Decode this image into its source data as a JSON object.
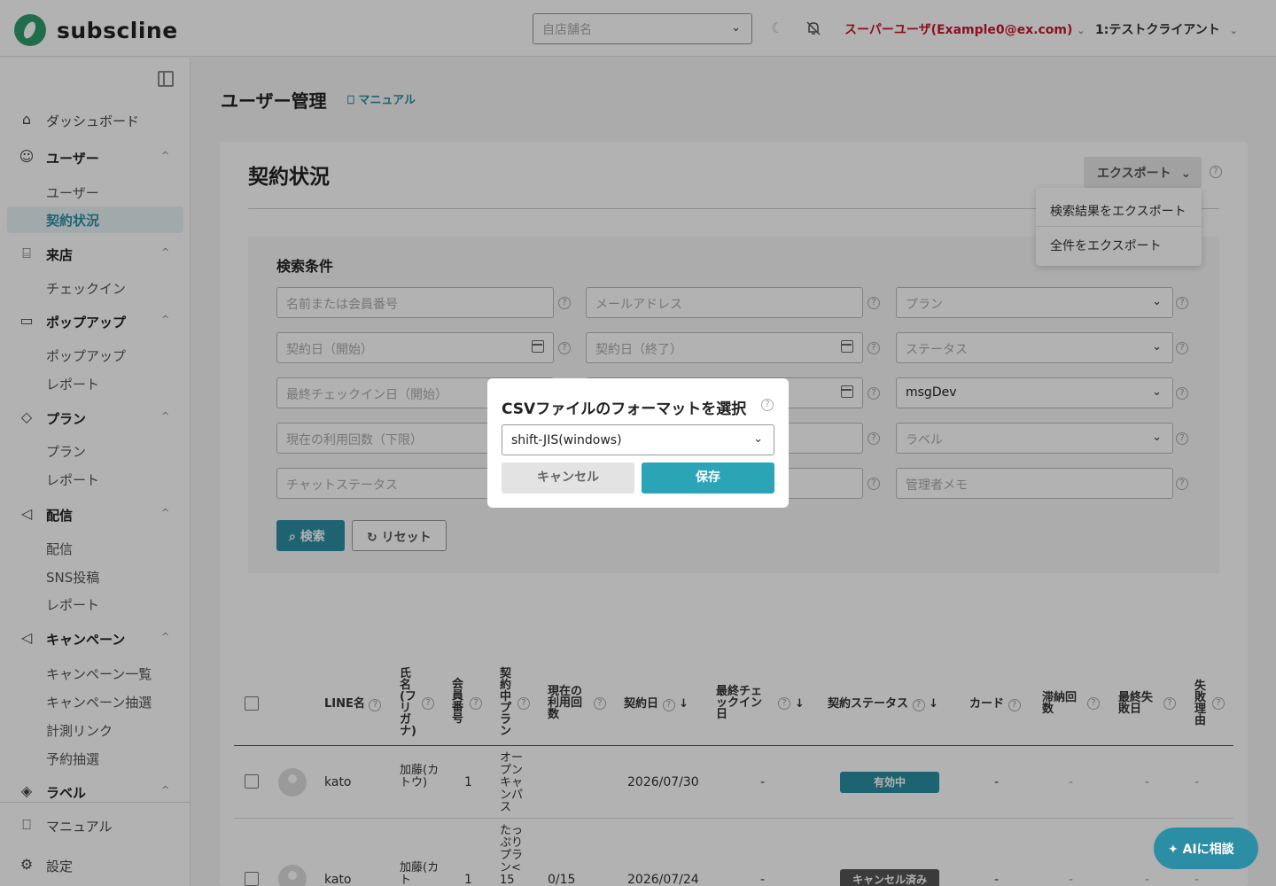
{
  "header": {
    "logo_text": "subscline",
    "store_placeholder": "自店舗名",
    "user_label": "スーパーユーザ(Example0@ex.com)",
    "client_label": "1:テストクライアント"
  },
  "sidebar": {
    "dashboard": "ダッシュボード",
    "users": {
      "label": "ユーザー",
      "items": [
        "ユーザー",
        "契約状況"
      ]
    },
    "visit": {
      "label": "来店",
      "items": [
        "チェックイン"
      ]
    },
    "popup": {
      "label": "ポップアップ",
      "items": [
        "ポップアップ",
        "レポート"
      ]
    },
    "plan": {
      "label": "プラン",
      "items": [
        "プラン",
        "レポート"
      ]
    },
    "delivery": {
      "label": "配信",
      "items": [
        "配信",
        "SNS投稿",
        "レポート"
      ]
    },
    "campaign": {
      "label": "キャンペーン",
      "items": [
        "キャンペーン一覧",
        "キャンペーン抽選",
        "計測リンク",
        "予約抽選"
      ]
    },
    "label": {
      "label": "ラベル"
    },
    "manual": "マニュアル",
    "settings": "設定"
  },
  "page": {
    "title": "ユーザー管理",
    "manual_link": "マニュアル",
    "card_title": "契約状況",
    "export_label": "エクスポート",
    "export_menu": [
      "検索結果をエクスポート",
      "全件をエクスポート"
    ]
  },
  "search": {
    "title": "検索条件",
    "fields": {
      "name": "名前または会員番号",
      "email": "メールアドレス",
      "plan": "プラン",
      "contract_start": "契約日（開始）",
      "contract_end": "契約日（終了）",
      "status": "ステータス",
      "checkin_start": "最終チェックイン日（開始）",
      "store_value": "msgDev",
      "usage_min": "現在の利用回数（下限）",
      "label": "ラベル",
      "chat_status": "チャットステータス",
      "admin_memo": "管理者メモ"
    },
    "search_button": "検索",
    "reset_button": "リセット"
  },
  "table": {
    "headers": {
      "line_name": "LINE名",
      "kana": "氏名(フリガナ)",
      "member_no": "会員番号",
      "plan": "契約中プラン",
      "usage": "現在の利用回数",
      "contract_date": "契約日",
      "last_checkin": "最終チェックイン日",
      "status": "契約ステータス",
      "card": "カード",
      "overdue": "滞納回数",
      "last_fail": "最終失敗日",
      "fail_reason": "失敗理由"
    },
    "rows": [
      {
        "line_name": "kato",
        "kana": "加藤(カトウ)",
        "member_no": "1",
        "plan": "オープンキャンパス",
        "usage": "",
        "contract_date": "2026/07/30",
        "last_checkin": "-",
        "status": "有効中",
        "status_color": "#2b8ea4",
        "card": "-",
        "overdue": "-",
        "last_fail": "-",
        "fail_reason": "-"
      },
      {
        "line_name": "kato",
        "kana": "加藤(カト",
        "member_no": "1",
        "plan": "たっぷりプラン<15",
        "usage": "0/15",
        "contract_date": "2026/07/24",
        "last_checkin": "-",
        "status": "キャンセル済み",
        "status_color": "#555555",
        "card": "-",
        "overdue": "-",
        "last_fail": "-",
        "fail_reason": "-"
      }
    ]
  },
  "modal": {
    "title": "CSVファイルのフォーマットを選択",
    "selected_format": "shift-JIS(windows)",
    "cancel_label": "キャンセル",
    "save_label": "保存"
  },
  "ai_button": "AIに相談",
  "colors": {
    "accent": "#2b8ea4",
    "user_red": "#c8192e"
  }
}
